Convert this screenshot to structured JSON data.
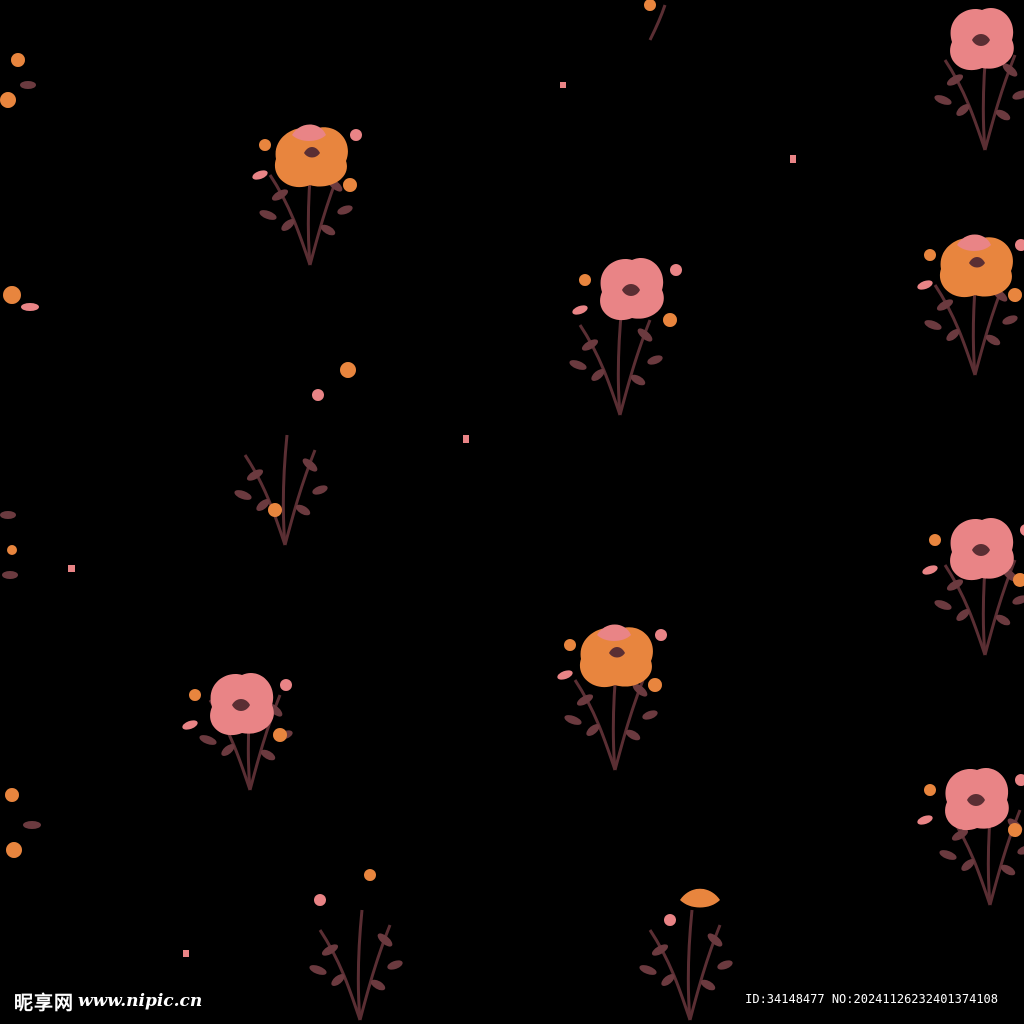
{
  "image": {
    "description_colors": {
      "background": "#000000",
      "pink": "#e98486",
      "orange": "#e8853e",
      "stem": "#5a2e33",
      "leaf_dark": "#6b3a3f"
    }
  },
  "watermark": {
    "logo_text": "昵享网",
    "site": "www.nipic.cn",
    "id_text": "ID:34148477 NO:20241126232401374108"
  }
}
